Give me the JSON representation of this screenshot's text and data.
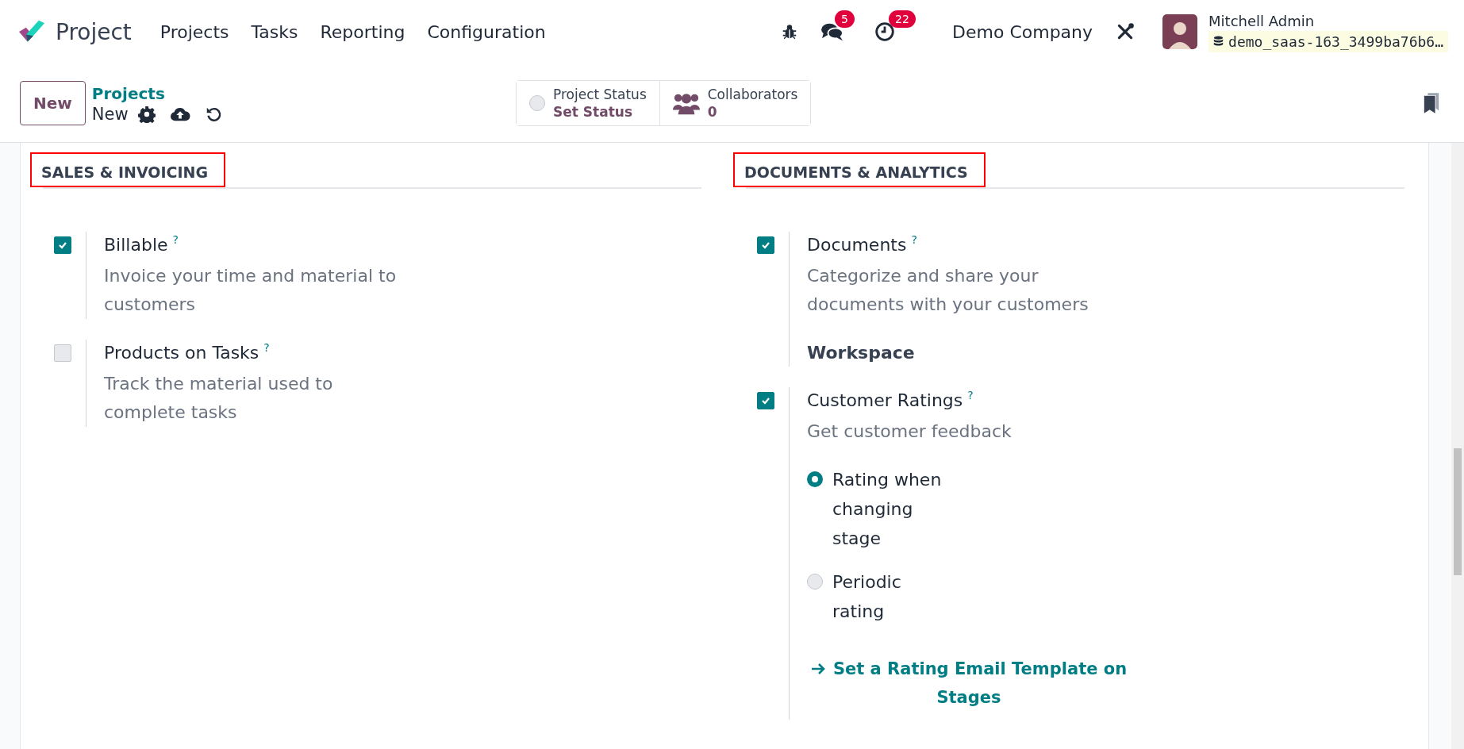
{
  "navbar": {
    "app_name": "Project",
    "menu": [
      "Projects",
      "Tasks",
      "Reporting",
      "Configuration"
    ],
    "messages_badge": "5",
    "activities_badge": "22",
    "company": "Demo Company",
    "user_name": "Mitchell Admin",
    "database": "demo_saas-163_3499ba76b6…"
  },
  "control_panel": {
    "new_button": "New",
    "breadcrumb": "Projects",
    "current": "New",
    "status": {
      "label": "Project Status",
      "value": "Set Status"
    },
    "collaborators": {
      "label": "Collaborators",
      "count": "0"
    }
  },
  "sections": [
    {
      "title": "SALES & INVOICING",
      "highlighted": true,
      "settings": [
        {
          "label": "Billable",
          "help_mark": "?",
          "checked": true,
          "description": "Invoice your time and material to customers"
        },
        {
          "label": "Products on Tasks",
          "help_mark": "?",
          "checked": false,
          "description": "Track the material used to complete tasks"
        }
      ]
    },
    {
      "title": "DOCUMENTS & ANALYTICS",
      "highlighted": true,
      "settings": [
        {
          "label": "Documents",
          "help_mark": "?",
          "checked": true,
          "description": "Categorize and share your documents with your customers",
          "field_label": "Workspace"
        },
        {
          "label": "Customer Ratings",
          "help_mark": "?",
          "checked": true,
          "description": "Get customer feedback",
          "options": [
            {
              "label": "Rating when changing stage",
              "selected": true
            },
            {
              "label": "Periodic rating",
              "selected": false
            }
          ],
          "link": "Set a Rating Email Template on Stages"
        }
      ]
    }
  ]
}
